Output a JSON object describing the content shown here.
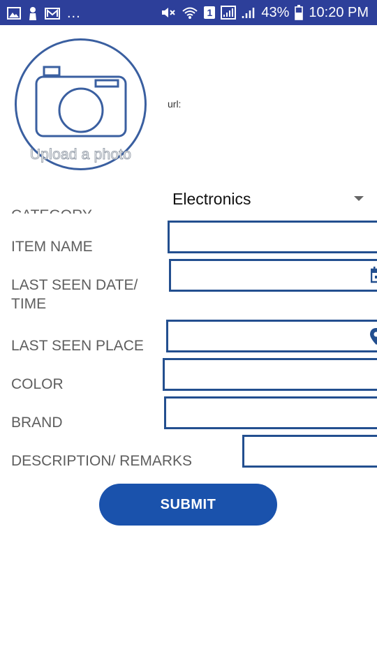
{
  "status_bar": {
    "overflow": "...",
    "battery_percent": "43%",
    "sim_badge": "1",
    "time": "10:20 PM",
    "icons": [
      "gallery-icon",
      "person-icon",
      "mail-icon",
      "mute-icon",
      "wifi-icon",
      "sim-signal-icon",
      "signal-icon",
      "battery-icon"
    ],
    "color": "#2d3f9a"
  },
  "photo": {
    "upload_text": "Upload a photo",
    "icon": "camera-icon"
  },
  "url_label": "url:",
  "category": {
    "label": "CATEGORY",
    "selected": "Electronics",
    "icon": "dropdown-arrow-icon"
  },
  "fields": {
    "item_name": {
      "label": "ITEM NAME",
      "value": ""
    },
    "last_seen_datetime": {
      "label_line1": "LAST SEEN DATE/",
      "label_line2": "TIME",
      "value": "",
      "icon": "calendar-icon"
    },
    "last_seen_place": {
      "label": "LAST SEEN PLACE",
      "value": "",
      "icon": "location-pin-icon"
    },
    "color": {
      "label": "COLOR",
      "value": ""
    },
    "brand": {
      "label": "BRAND",
      "value": ""
    },
    "description": {
      "label": "DESCRIPTION/ REMARKS",
      "value": ""
    }
  },
  "submit": {
    "label": "SUBMIT",
    "color": "#1a52ac"
  },
  "accent_color": "#234f8f"
}
